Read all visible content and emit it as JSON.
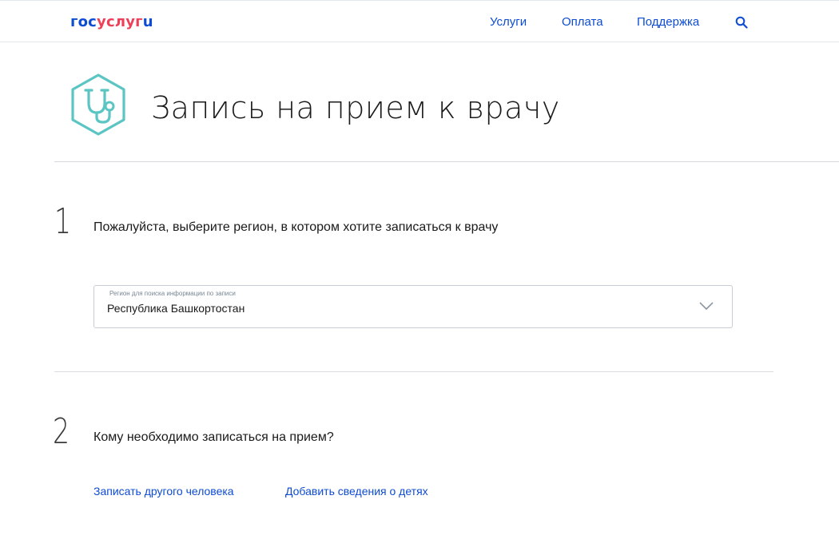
{
  "header": {
    "logo": {
      "part1": "гос",
      "part2": "услуг",
      "part3": "u"
    },
    "nav": [
      "Услуги",
      "Оплата",
      "Поддержка"
    ],
    "search_icon": "search-icon"
  },
  "page": {
    "service_icon": "stethoscope-icon",
    "title": "Запись на прием к врачу"
  },
  "steps": [
    {
      "number": "1",
      "question": "Пожалуйста, выберите регион, в котором хотите записаться к врачу",
      "select": {
        "label": "Регион для поиска информации по записи",
        "value": "Республика Башкортостан",
        "icon": "chevron-down-icon"
      }
    },
    {
      "number": "2",
      "question": "Кому необходимо записаться на прием?",
      "links": [
        "Записать другого человека",
        "Добавить сведения о детях"
      ]
    }
  ],
  "colors": {
    "accent": "#0d4cd3",
    "brand_red": "#ee3f58",
    "icon_teal": "#5bc5c4"
  }
}
